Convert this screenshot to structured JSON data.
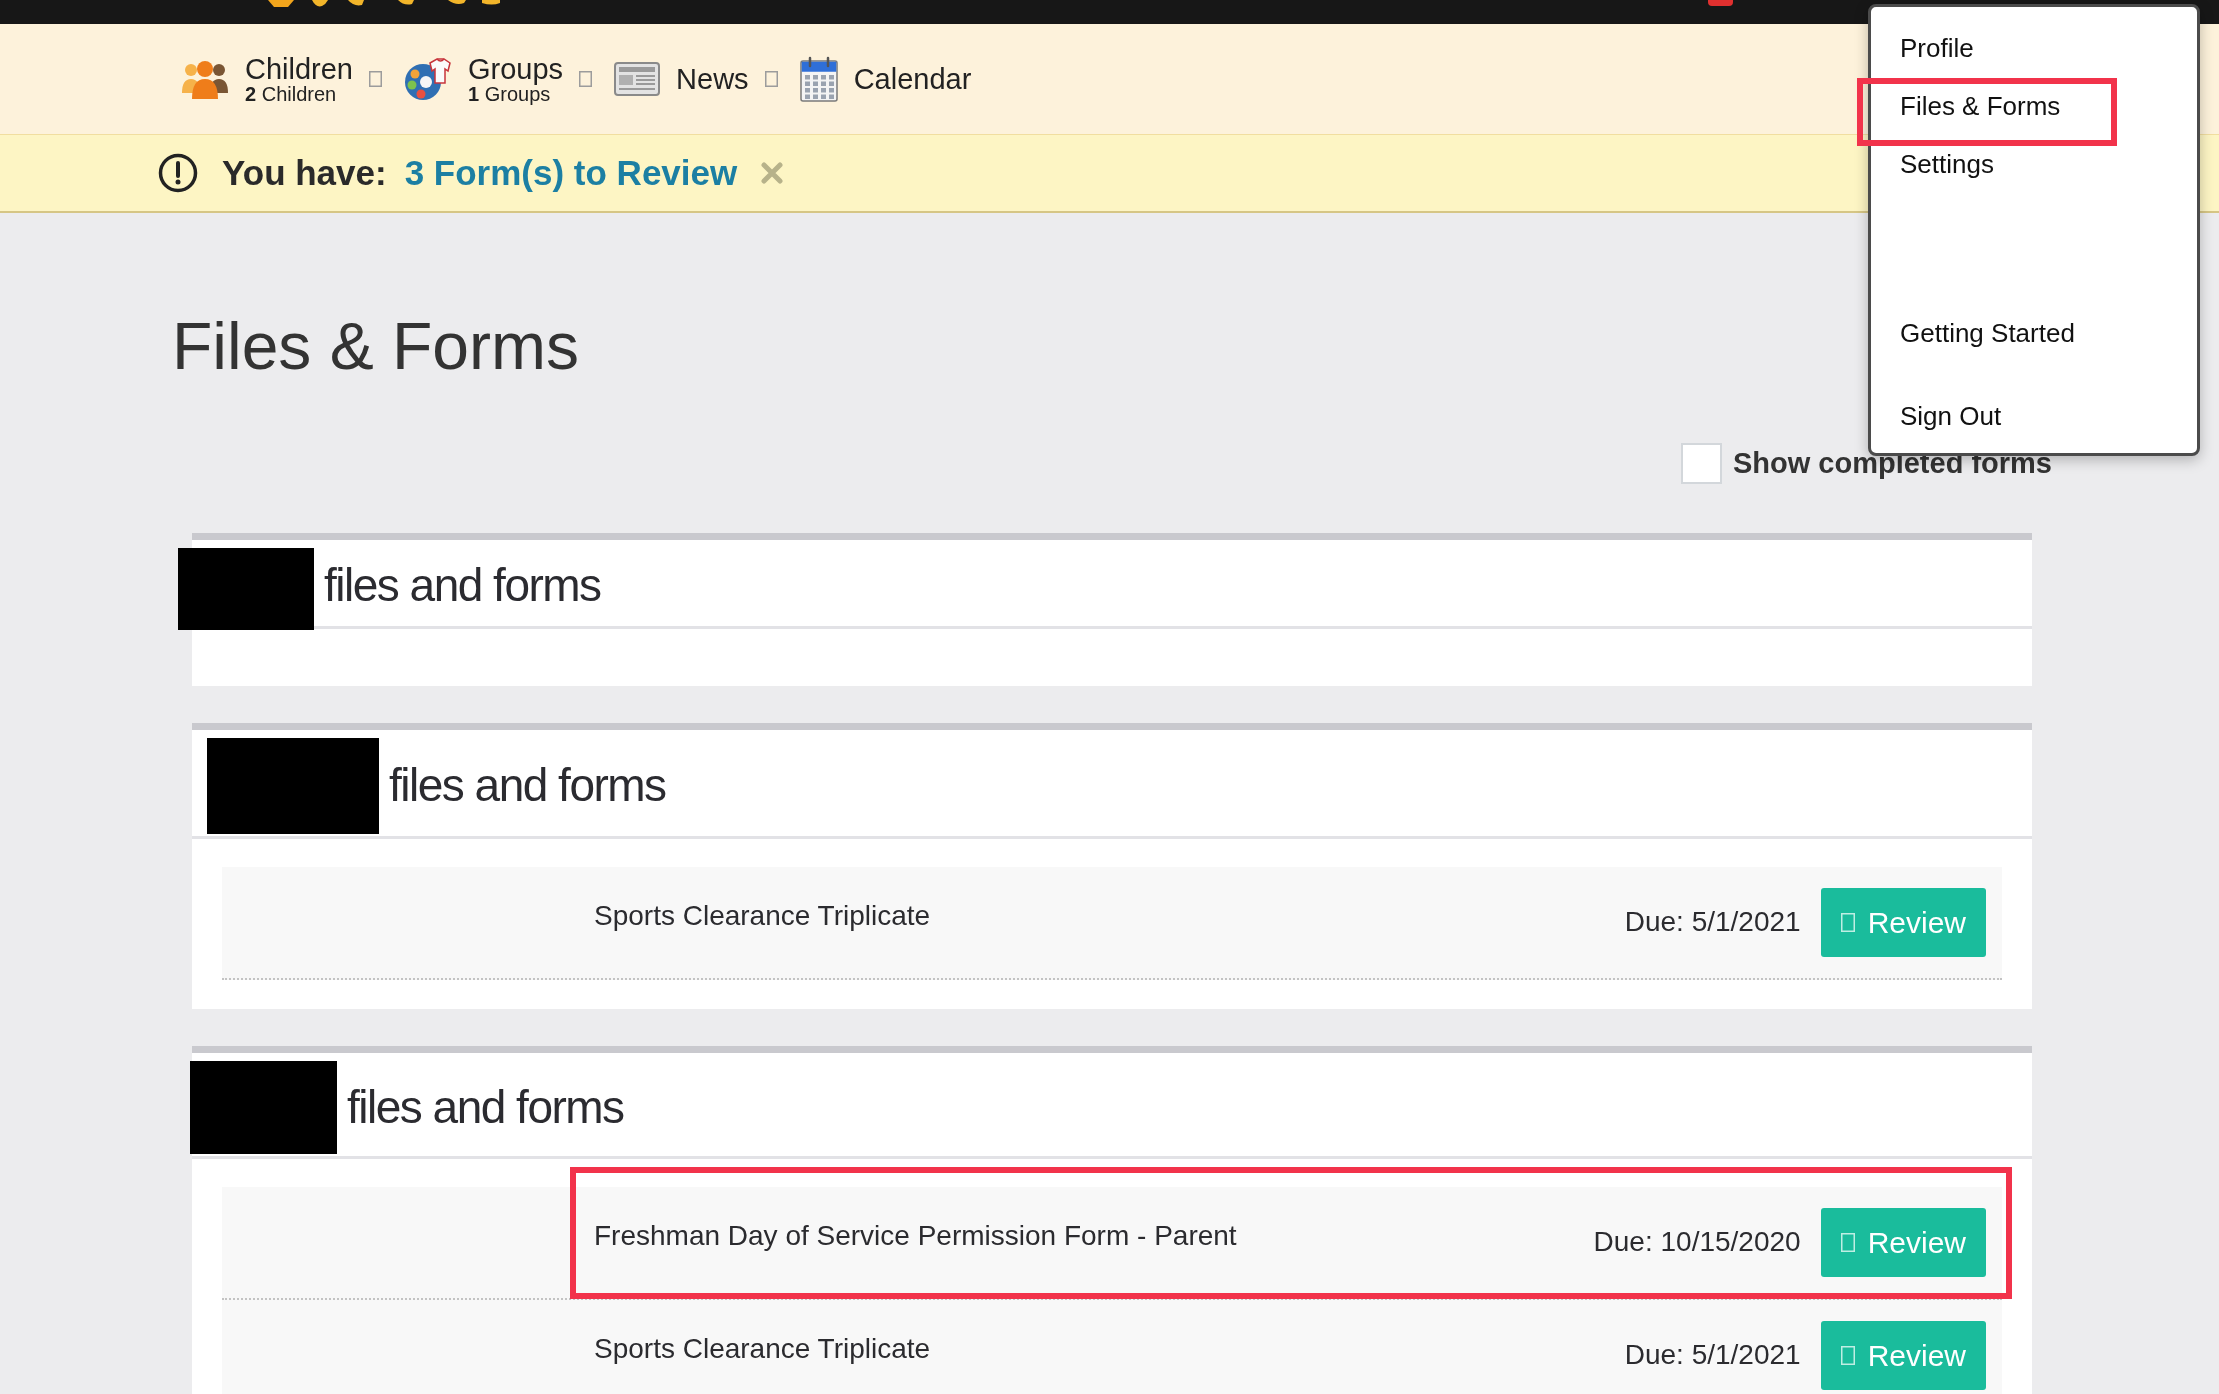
{
  "nav": {
    "items": [
      {
        "label": "Children",
        "subtitle": "**2** Children",
        "dropdown": true
      },
      {
        "label": "Groups",
        "subtitle": "**1** Groups",
        "dropdown": true
      },
      {
        "label": "News",
        "dropdown": true
      },
      {
        "label": "Calendar",
        "dropdown": false
      }
    ]
  },
  "alert": {
    "prefix": "You have:",
    "link": "3 Form(s) to Review",
    "dismissible": true
  },
  "page_title": "Files & Forms",
  "show_completed": {
    "label": "Show completed forms",
    "checked": false
  },
  "sections": [
    {
      "heading": "files and forms",
      "name_redacted": true
    },
    {
      "heading": "files and forms",
      "name_redacted": true,
      "forms": [
        {
          "title": "Sports Clearance Triplicate",
          "due": "Due: 5/1/2021",
          "button": "Review",
          "highlighted": false
        }
      ]
    },
    {
      "heading": "files and forms",
      "name_redacted": true,
      "forms": [
        {
          "title": "Freshman Day of Service Permission Form - Parent",
          "due": "Due: 10/15/2020",
          "button": "Review",
          "highlighted": true
        },
        {
          "title": "Sports Clearance Triplicate",
          "due": "Due: 5/1/2021",
          "button": "Review",
          "highlighted": false
        }
      ]
    }
  ],
  "user_menu": {
    "items": [
      {
        "kind": "link",
        "label": "Profile",
        "highlighted": false
      },
      {
        "kind": "link",
        "label": "Files & Forms",
        "highlighted": true
      },
      {
        "kind": "link",
        "label": "Settings",
        "highlighted": false
      },
      {
        "kind": "separator"
      },
      {
        "kind": "link",
        "label": "Getting Started",
        "highlighted": false
      },
      {
        "kind": "separator"
      },
      {
        "kind": "link",
        "label": "Sign Out",
        "highlighted": false
      }
    ]
  }
}
